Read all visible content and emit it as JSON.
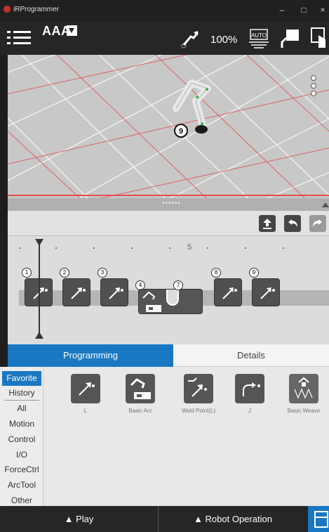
{
  "window": {
    "title": "iRProgrammer",
    "min": "–",
    "max": "□",
    "close": "×"
  },
  "toolbar": {
    "program_name": "AAA",
    "speed": "100%",
    "auto_badge": "AUTO"
  },
  "view3d": {
    "dots_label": "••••••"
  },
  "timeline": {
    "ruler_label": "5",
    "nodes": [
      {
        "num": "1",
        "icon": "linear-move-icon"
      },
      {
        "num": "2",
        "icon": "linear-move-icon"
      },
      {
        "num": "3",
        "icon": "linear-move-icon"
      },
      {
        "num": "4",
        "icon": "basic-arc-icon"
      },
      {
        "num": "7",
        "icon": "arc-block-icon"
      },
      {
        "num": "8",
        "icon": "linear-move-icon"
      },
      {
        "num": "9",
        "icon": "linear-move-icon"
      }
    ],
    "robot_marker": "9"
  },
  "tabs": {
    "programming": "Programming",
    "details": "Details"
  },
  "categories": [
    "Favorite",
    "History",
    "All",
    "Motion",
    "Control",
    "I/O",
    "ForceCtrl",
    "ArcTool",
    "Other"
  ],
  "palette": [
    {
      "label": "L",
      "icon": "linear-move-icon"
    },
    {
      "label": "Basic Arc",
      "icon": "basic-arc-icon"
    },
    {
      "label": "Weld Point(L)",
      "icon": "weld-point-icon"
    },
    {
      "label": "J",
      "icon": "joint-move-icon"
    },
    {
      "label": "Basic Weave",
      "icon": "basic-weave-icon"
    }
  ],
  "bottom": {
    "play": "▲ Play",
    "robot_operation": "▲ Robot Operation"
  },
  "colors": {
    "accent": "#1a78c2",
    "dark": "#262626"
  }
}
